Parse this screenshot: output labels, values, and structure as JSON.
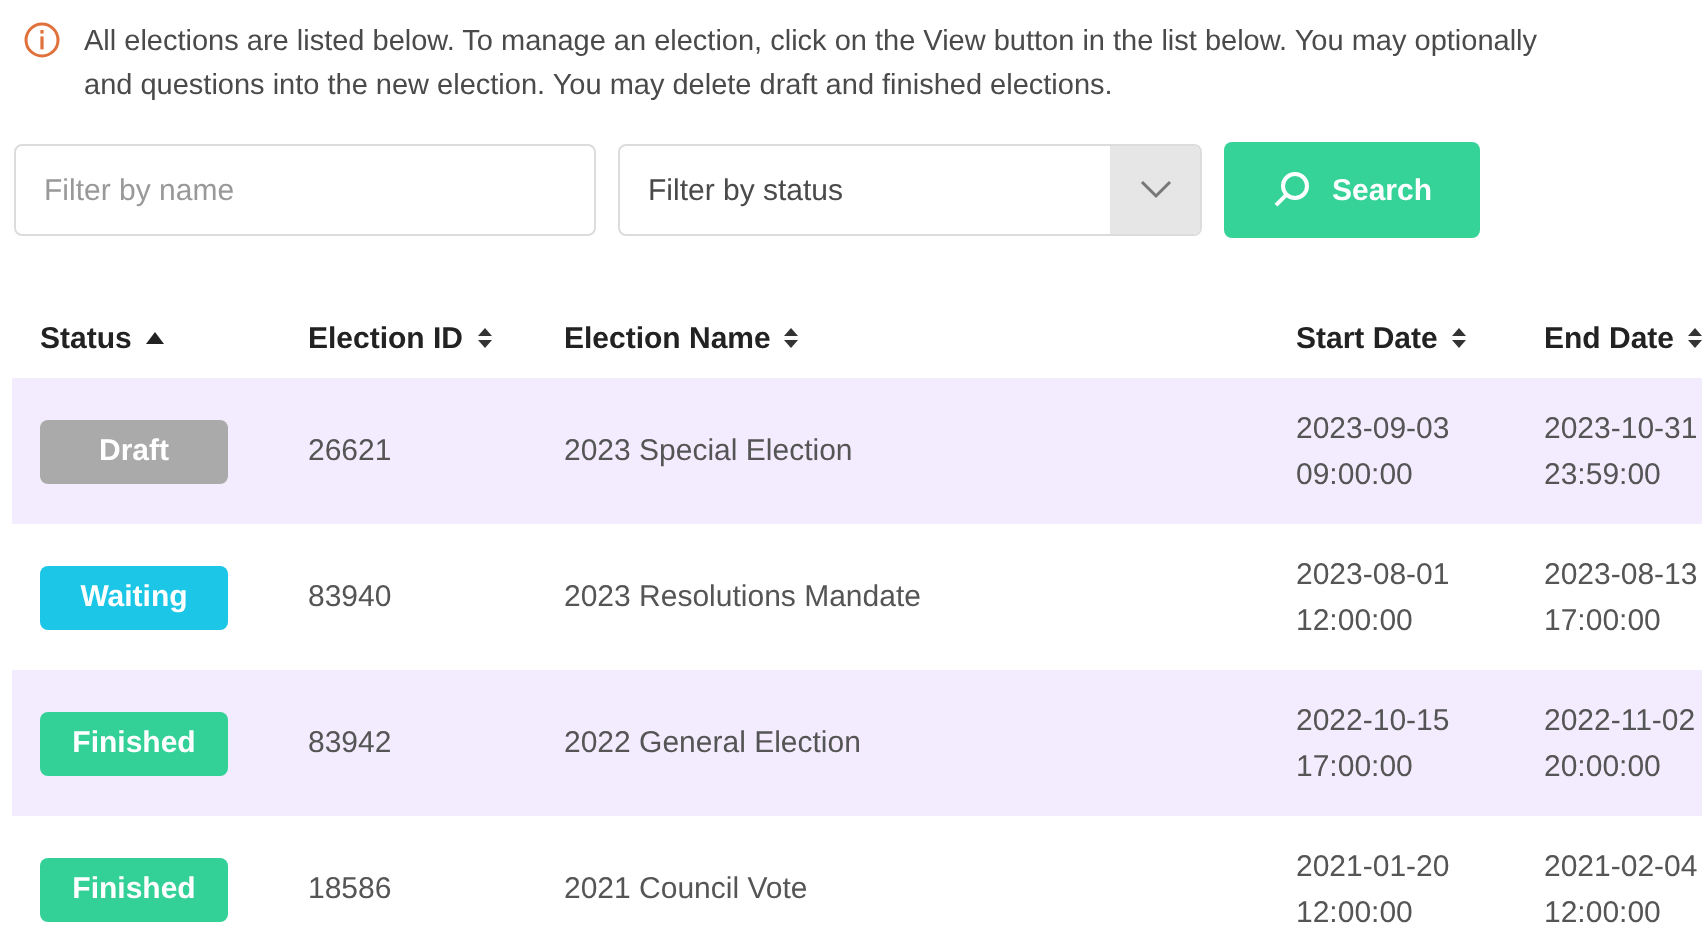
{
  "notice": {
    "lines": [
      "All elections are listed below. To manage an election, click on the View button in the list below. You may optionally",
      "and questions into the new election. You may delete draft and finished elections."
    ]
  },
  "filters": {
    "name": {
      "placeholder": "Filter by name"
    },
    "status": {
      "placeholder": "Filter by status"
    },
    "search_button": "Search"
  },
  "table": {
    "columns": [
      {
        "label": "Status",
        "sorted": true
      },
      {
        "label": "Election ID",
        "sorted": false
      },
      {
        "label": "Election Name",
        "sorted": false
      },
      {
        "label": "Start Date",
        "sorted": false
      },
      {
        "label": "End Date",
        "sorted": false
      }
    ],
    "rows": [
      {
        "status": {
          "label": "Draft",
          "color": "#aaaaaa"
        },
        "id": "26621",
        "name": "2023 Special Election",
        "start": [
          "2023-09-03",
          "09:00:00"
        ],
        "end": [
          "2023-10-31",
          "23:59:00"
        ]
      },
      {
        "status": {
          "label": "Waiting",
          "color": "#1cc6e6"
        },
        "id": "83940",
        "name": "2023 Resolutions Mandate",
        "start": [
          "2023-08-01",
          "12:00:00"
        ],
        "end": [
          "2023-08-13",
          "17:00:00"
        ]
      },
      {
        "status": {
          "label": "Finished",
          "color": "#33d198"
        },
        "id": "83942",
        "name": "2022 General Election",
        "start": [
          "2022-10-15",
          "17:00:00"
        ],
        "end": [
          "2022-11-02",
          "20:00:00"
        ]
      },
      {
        "status": {
          "label": "Finished",
          "color": "#33d198"
        },
        "id": "18586",
        "name": "2021 Council Vote",
        "start": [
          "2021-01-20",
          "12:00:00"
        ],
        "end": [
          "2021-02-04",
          "12:00:00"
        ]
      }
    ]
  }
}
